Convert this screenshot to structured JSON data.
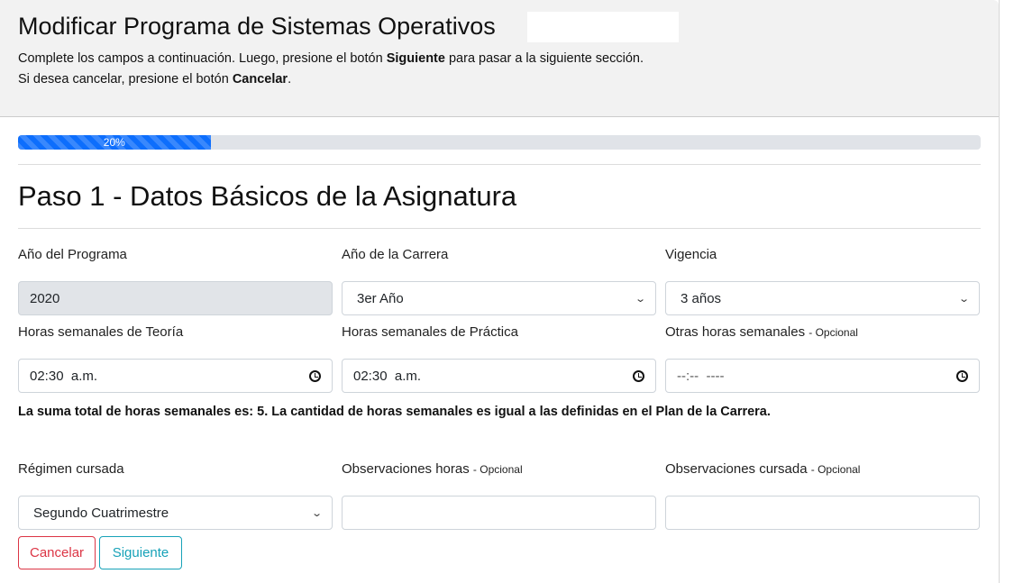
{
  "header": {
    "title": "Modificar Programa de Sistemas Operativos",
    "line1_pre": "Complete los campos a continuación. Luego, presione el botón ",
    "line1_bold": "Siguiente",
    "line1_post": " para pasar a la siguiente sección.",
    "line2_pre": "Si desea cancelar, presione el botón ",
    "line2_bold": "Cancelar",
    "line2_post": "."
  },
  "progress": {
    "value": 20,
    "label": "20%",
    "color": "#0d6efd"
  },
  "step_title": "Paso 1 - Datos Básicos de la Asignatura",
  "fields": {
    "anio_programa": {
      "label": "Año del Programa",
      "value": "2020"
    },
    "anio_carrera": {
      "label": "Año de la Carrera",
      "value": "3er Año"
    },
    "vigencia": {
      "label": "Vigencia",
      "value": "3 años"
    },
    "horas_teoria": {
      "label": "Horas semanales de Teoría",
      "value": "02:30  a.m."
    },
    "horas_practica": {
      "label": "Horas semanales de Práctica",
      "value": "02:30  a.m."
    },
    "otras_horas": {
      "label": "Otras horas semanales",
      "optional": "- Opcional",
      "value": "--:--  ----"
    },
    "regimen": {
      "label": "Régimen cursada",
      "value": "Segundo Cuatrimestre"
    },
    "obs_horas": {
      "label": "Observaciones horas",
      "optional": "- Opcional",
      "value": ""
    },
    "obs_cursada": {
      "label": "Observaciones cursada",
      "optional": "- Opcional",
      "value": ""
    }
  },
  "summary": "La suma total de horas semanales es: 5. La cantidad de horas semanales es igual a las definidas en el Plan de la Carrera.",
  "buttons": {
    "cancel": "Cancelar",
    "next": "Siguiente",
    "cancel_color": "#dc3545",
    "next_color": "#17a2b8"
  }
}
